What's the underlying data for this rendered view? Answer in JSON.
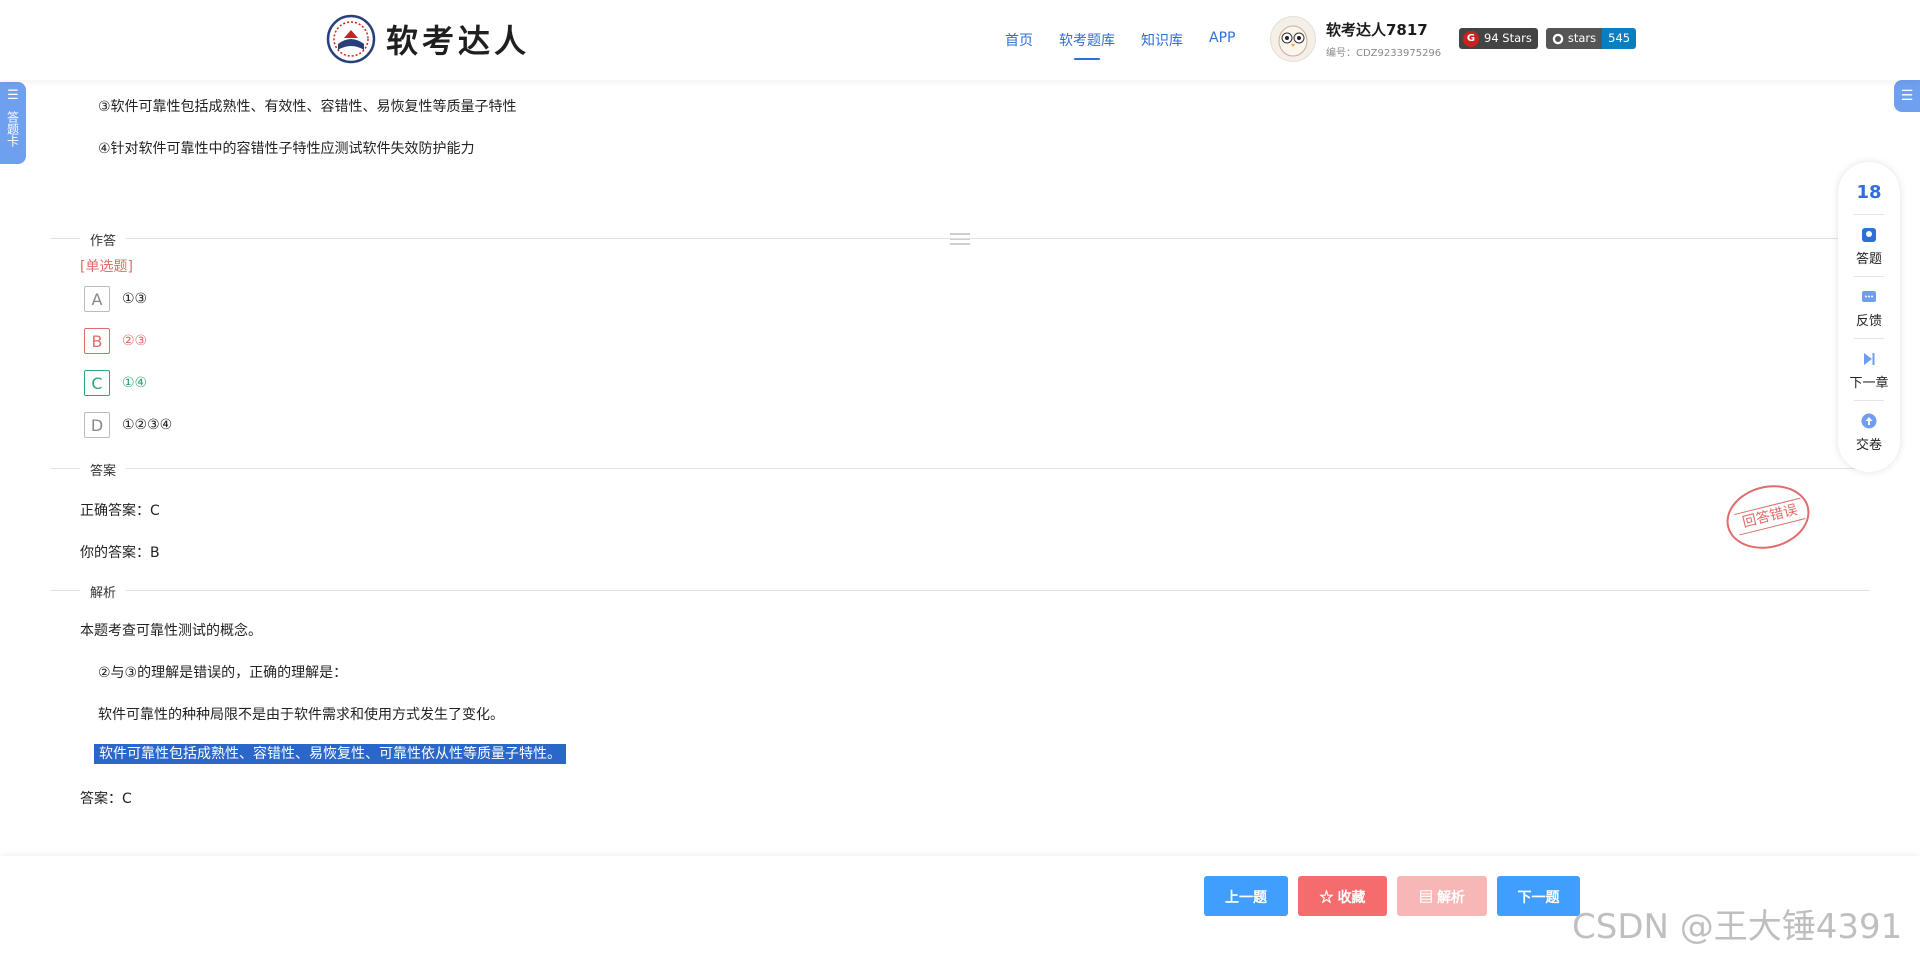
{
  "header": {
    "logo_text": "软考达人",
    "nav": [
      "首页",
      "软考题库",
      "知识库",
      "APP"
    ],
    "active_nav": "软考题库",
    "user": {
      "name": "软考达人7817",
      "id": "编号：CDZ9233975296"
    },
    "badges": {
      "gitee": "94 Stars",
      "github_label": "stars",
      "github_count": "545"
    }
  },
  "side": {
    "left_tab": "答题卡"
  },
  "question": {
    "statements": [
      "③软件可靠性包括成熟性、有效性、容错性、易恢复性等质量子特性",
      "④针对软件可靠性中的容错性子特性应测试软件失效防护能力"
    ],
    "answer_section_label": "作答",
    "type_tag": "[单选题]",
    "options": [
      {
        "letter": "A",
        "text": "①③",
        "state": "normal"
      },
      {
        "letter": "B",
        "text": "②③",
        "state": "wrong"
      },
      {
        "letter": "C",
        "text": "①④",
        "state": "correct"
      },
      {
        "letter": "D",
        "text": "①②③④",
        "state": "normal"
      }
    ]
  },
  "answer": {
    "section_label": "答案",
    "correct": "正确答案：C",
    "yours": "你的答案：B",
    "stamp": "回答错误"
  },
  "analysis": {
    "section_label": "解析",
    "lines": [
      "本题考查可靠性测试的概念。",
      "②与③的理解是错误的，正确的理解是：",
      "软件可靠性的种种局限不是由于软件需求和使用方式发生了变化。",
      "软件可靠性包括成熟性、容错性、易恢复性、可靠性依从性等质量子特性。",
      "答案：C"
    ]
  },
  "panel": {
    "count": "18",
    "items": [
      "答题",
      "反馈",
      "下一章",
      "交卷"
    ]
  },
  "footer": {
    "prev": "上一题",
    "fav": "收藏",
    "analysis": "解析",
    "next": "下一题"
  },
  "watermark": "CSDN @王大锤4391"
}
